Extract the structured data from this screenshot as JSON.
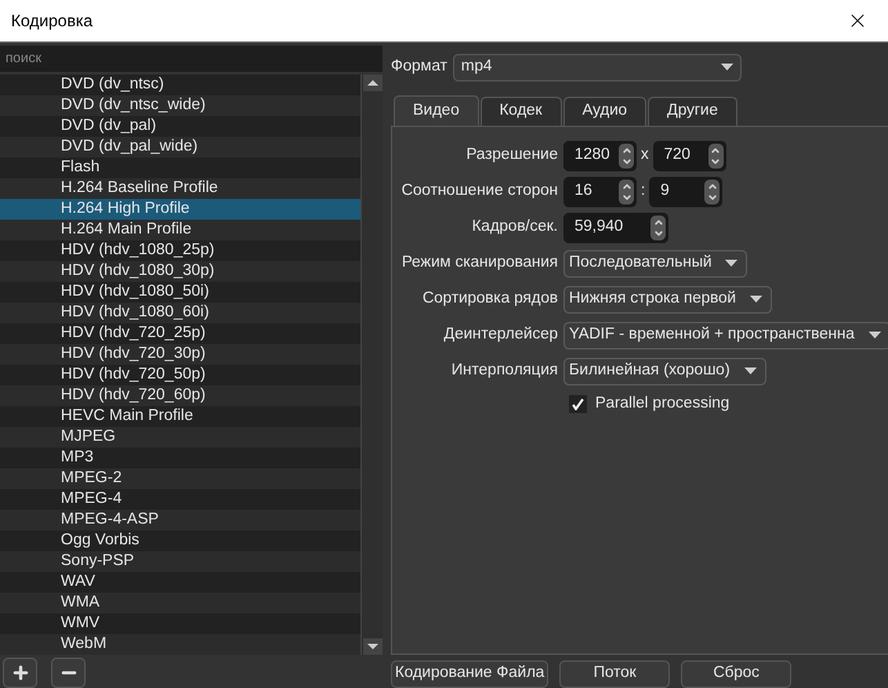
{
  "window": {
    "title": "Кодировка"
  },
  "search": {
    "placeholder": "поиск"
  },
  "presets": [
    {
      "label": "DVD (dv_ntsc)",
      "selected": false
    },
    {
      "label": "DVD (dv_ntsc_wide)",
      "selected": false
    },
    {
      "label": "DVD (dv_pal)",
      "selected": false
    },
    {
      "label": "DVD (dv_pal_wide)",
      "selected": false
    },
    {
      "label": "Flash",
      "selected": false
    },
    {
      "label": "H.264 Baseline Profile",
      "selected": false
    },
    {
      "label": "H.264 High Profile",
      "selected": true
    },
    {
      "label": "H.264 Main Profile",
      "selected": false
    },
    {
      "label": "HDV (hdv_1080_25p)",
      "selected": false
    },
    {
      "label": "HDV (hdv_1080_30p)",
      "selected": false
    },
    {
      "label": "HDV (hdv_1080_50i)",
      "selected": false
    },
    {
      "label": "HDV (hdv_1080_60i)",
      "selected": false
    },
    {
      "label": "HDV (hdv_720_25p)",
      "selected": false
    },
    {
      "label": "HDV (hdv_720_30p)",
      "selected": false
    },
    {
      "label": "HDV (hdv_720_50p)",
      "selected": false
    },
    {
      "label": "HDV (hdv_720_60p)",
      "selected": false
    },
    {
      "label": "HEVC Main Profile",
      "selected": false
    },
    {
      "label": "MJPEG",
      "selected": false
    },
    {
      "label": "MP3",
      "selected": false
    },
    {
      "label": "MPEG-2",
      "selected": false
    },
    {
      "label": "MPEG-4",
      "selected": false
    },
    {
      "label": "MPEG-4-ASP",
      "selected": false
    },
    {
      "label": "Ogg Vorbis",
      "selected": false
    },
    {
      "label": "Sony-PSP",
      "selected": false
    },
    {
      "label": "WAV",
      "selected": false
    },
    {
      "label": "WMA",
      "selected": false
    },
    {
      "label": "WMV",
      "selected": false
    },
    {
      "label": "WebM",
      "selected": false
    }
  ],
  "format": {
    "label": "Формат",
    "value": "mp4"
  },
  "tabs": [
    {
      "label": "Видео",
      "selected": true
    },
    {
      "label": "Кодек",
      "selected": false
    },
    {
      "label": "Аудио",
      "selected": false
    },
    {
      "label": "Другие",
      "selected": false
    }
  ],
  "fields": [
    {
      "kind": "spin2",
      "label": "Разрешение",
      "values": [
        "1280",
        "720"
      ],
      "separator": "x"
    },
    {
      "kind": "spin2",
      "label": "Соотношение сторон",
      "values": [
        "16",
        "9"
      ],
      "separator": ":"
    },
    {
      "kind": "spin",
      "label": "Кадров/сек.",
      "value": "59,940"
    },
    {
      "kind": "combo",
      "label": "Режим сканирования",
      "value": "Последовательный"
    },
    {
      "kind": "combo",
      "label": "Сортировка рядов",
      "value": "Нижняя строка первой"
    },
    {
      "kind": "combo",
      "label": "Деинтерлейсер",
      "value": "YADIF - временной + пространственна"
    },
    {
      "kind": "combo",
      "label": "Интерполяция",
      "value": "Билинейная (хорошо)"
    }
  ],
  "parallel": {
    "label": "Parallel processing",
    "checked": true
  },
  "buttons": [
    "Кодирование Файла",
    "Поток",
    "Сброс"
  ]
}
